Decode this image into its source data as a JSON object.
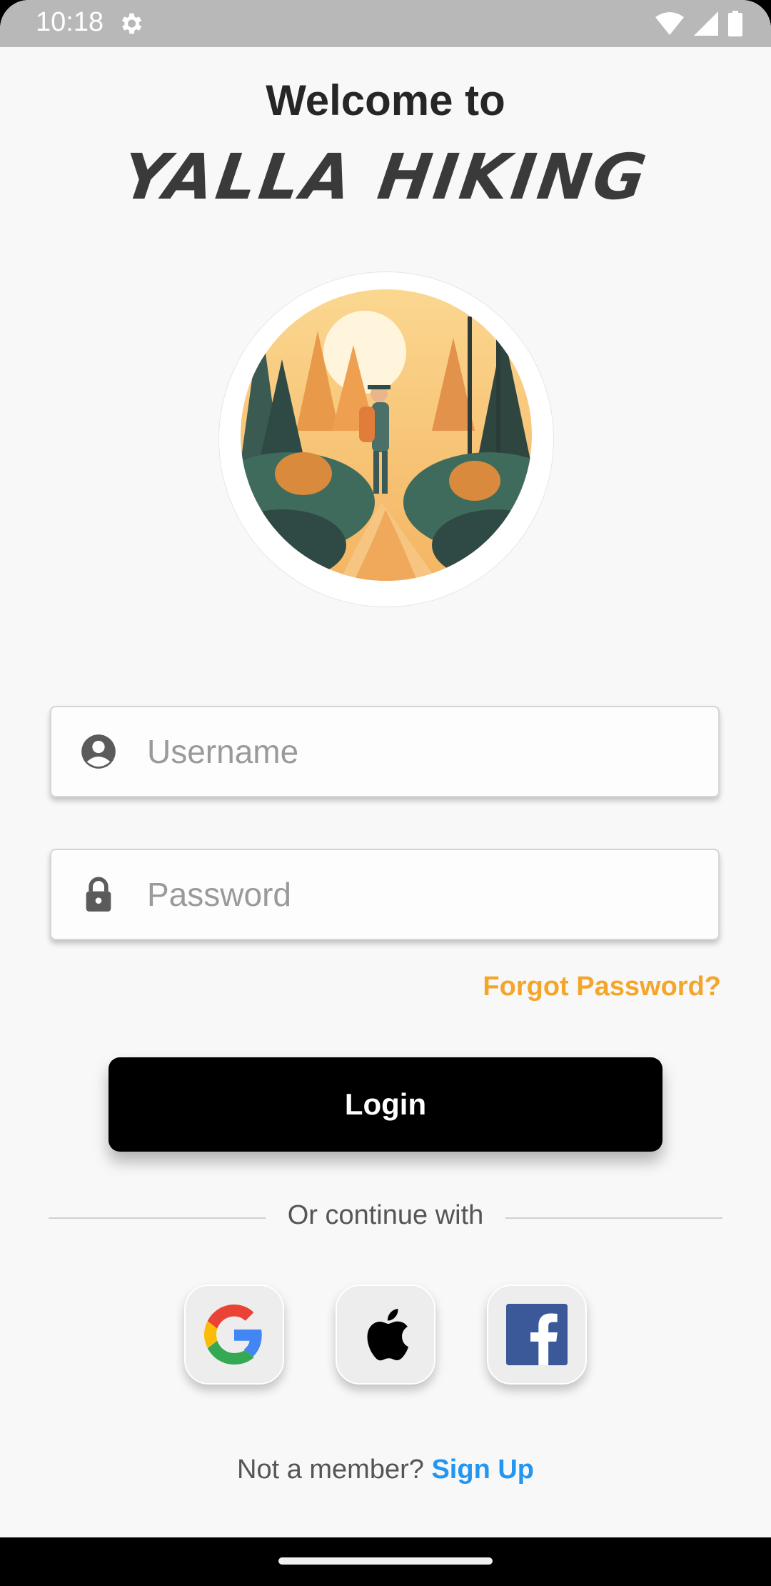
{
  "status_bar": {
    "time": "10:18"
  },
  "header": {
    "welcome": "Welcome to",
    "brand": "YALLA HIKING"
  },
  "form": {
    "username_placeholder": "Username",
    "password_placeholder": "Password",
    "forgot_password": "Forgot Password?",
    "login_label": "Login"
  },
  "divider": {
    "text": "Or continue with"
  },
  "social": [
    "google-icon",
    "apple-icon",
    "facebook-icon"
  ],
  "signup": {
    "prompt": "Not a member?",
    "link": "Sign Up"
  },
  "colors": {
    "accent": "#f4a62a",
    "link": "#2196f3",
    "button": "#000000"
  }
}
